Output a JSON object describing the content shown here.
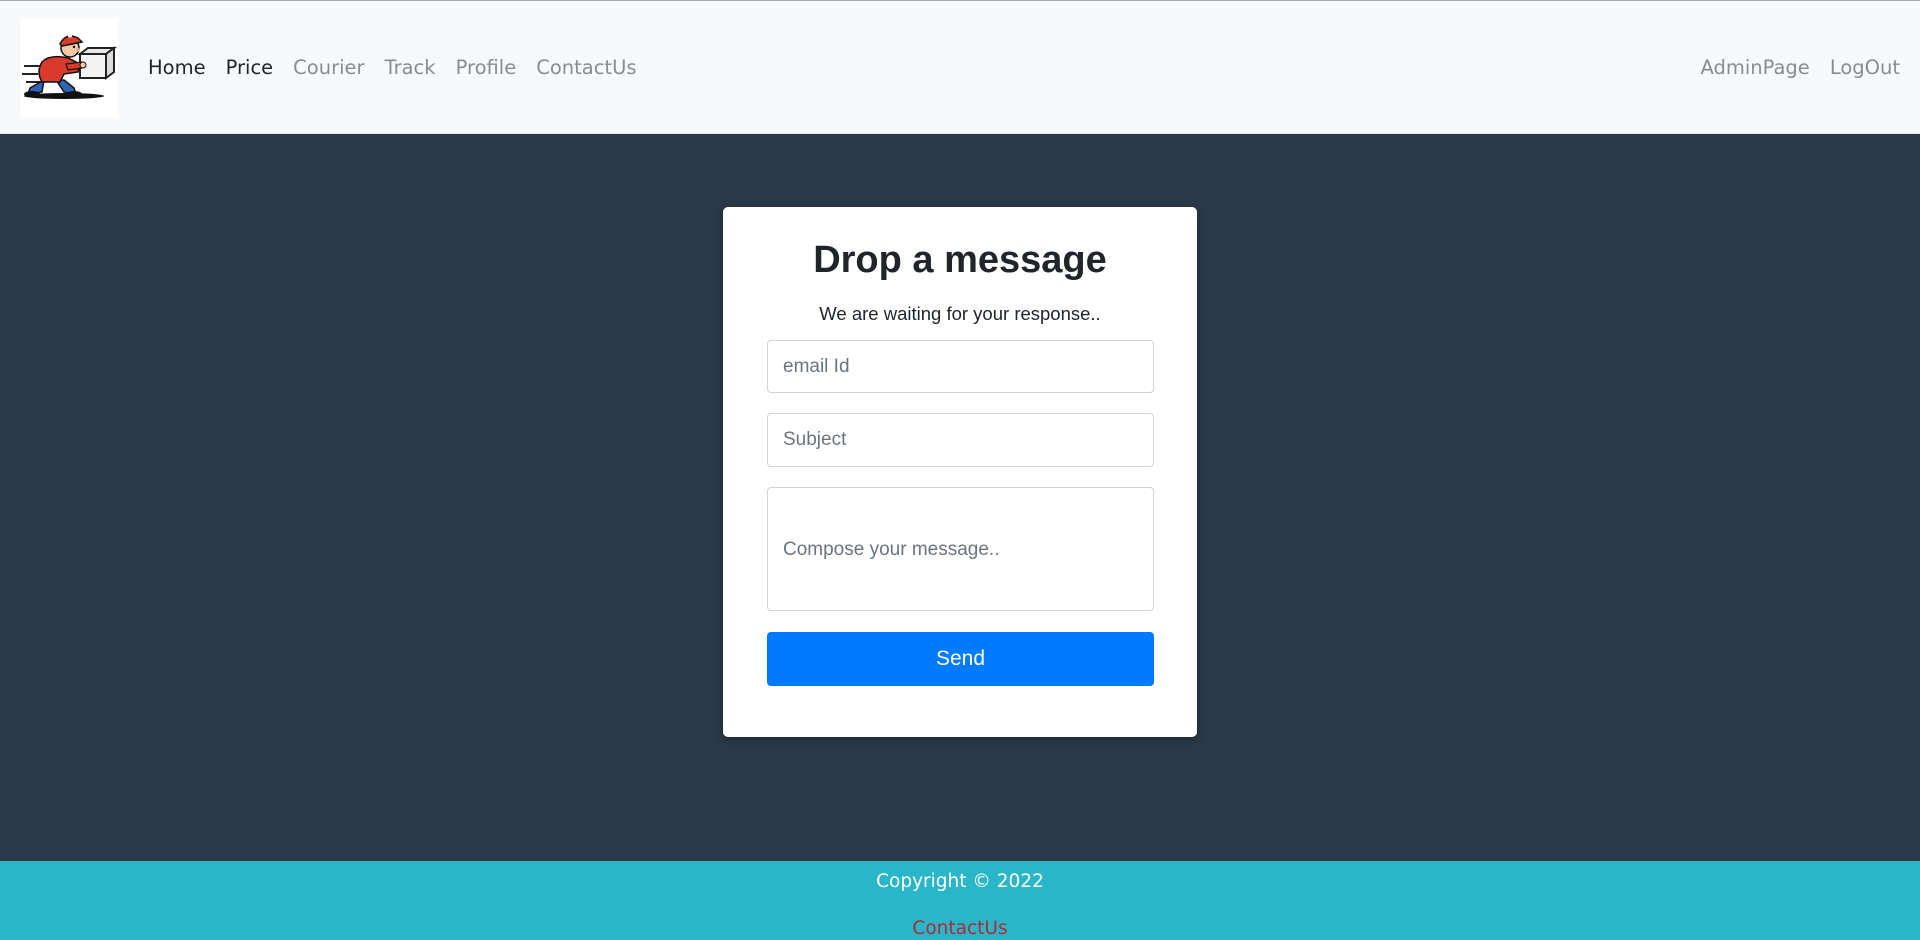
{
  "navbar": {
    "logo_icon": "courier-mascot-logo",
    "left_links": [
      {
        "label": "Home",
        "active": true
      },
      {
        "label": "Price",
        "active": true
      },
      {
        "label": "Courier",
        "active": false
      },
      {
        "label": "Track",
        "active": false
      },
      {
        "label": "Profile",
        "active": false
      },
      {
        "label": "ContactUs",
        "active": false
      }
    ],
    "right_links": [
      {
        "label": "AdminPage"
      },
      {
        "label": "LogOut"
      }
    ]
  },
  "form": {
    "title": "Drop a message",
    "subtitle": "We are waiting for your response..",
    "email_placeholder": "email Id",
    "subject_placeholder": "Subject",
    "message_placeholder": "Compose your message..",
    "send_label": "Send"
  },
  "footer": {
    "copyright": "Copyright © 2022",
    "contact_link": "ContactUs"
  },
  "colors": {
    "page_bg": "#2b3949",
    "navbar_bg": "#f8f9fa",
    "primary_button": "#007bff",
    "footer_bg": "#29b6c9",
    "footer_link": "#b02a37"
  }
}
